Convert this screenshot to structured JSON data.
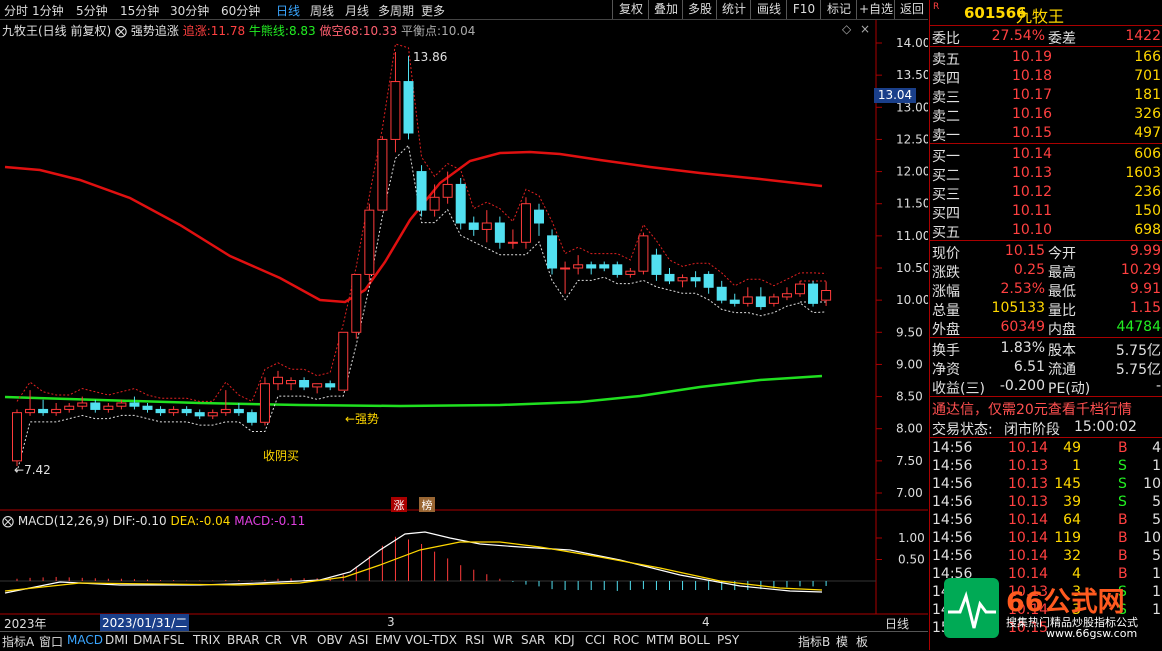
{
  "toolbar": {
    "periods": [
      "分时",
      "1分钟",
      "5分钟",
      "15分钟",
      "30分钟",
      "60分钟",
      "日线",
      "周线",
      "月线",
      "多周期",
      "更多"
    ],
    "active_period": "日线",
    "right_buttons": [
      "复权",
      "叠加",
      "多股",
      "统计",
      "画线",
      "F10",
      "标记",
      "+自选",
      "返回"
    ]
  },
  "chart": {
    "title": "九牧王(日线 前复权)",
    "indicator": "强势追涨",
    "zhuizhang_label": "追涨:",
    "zhuizhang_value": "11.78",
    "niu_label": "牛熊线:",
    "niu_value": "8.83",
    "zuokong_label": "做空68:",
    "zuokong_value": "10.33",
    "ping_label": "平衡点:",
    "ping_value": "10.04",
    "price_ticks": [
      "14.00",
      "13.50",
      "13.00",
      "12.50",
      "12.00",
      "11.50",
      "11.00",
      "10.50",
      "10.00",
      "9.50",
      "9.00",
      "8.50",
      "8.00",
      "7.50",
      "7.00"
    ],
    "current_price_tag": "13.04",
    "high_label": "13.86",
    "low_label": "7.42",
    "strong_label": "←强势",
    "buy_label": "收阴买",
    "zhang_tag": "涨",
    "bang_tag": "榜",
    "macd_label": "MACD(12,26,9)",
    "dif_label": "DIF:",
    "dif_value": "-0.10",
    "dea_label": "DEA:",
    "dea_value": "-0.04",
    "macd_val_label": "MACD:",
    "macd_value": "-0.11",
    "macd_ticks": [
      "1.00",
      "0.50"
    ],
    "date_left": "2023年",
    "date_cursor": "2023/01/31/二",
    "month3": "3",
    "month4": "4",
    "period_tag": "日线"
  },
  "chart_data": {
    "type": "candlestick",
    "ylim": [
      6.8,
      14.3
    ],
    "candles": [
      [
        7.5,
        8.3,
        8.25,
        7.42
      ],
      [
        8.25,
        8.6,
        8.3,
        8.2
      ],
      [
        8.3,
        8.45,
        8.25,
        8.2
      ],
      [
        8.25,
        8.4,
        8.3,
        8.2
      ],
      [
        8.3,
        8.4,
        8.35,
        8.25
      ],
      [
        8.35,
        8.5,
        8.4,
        8.3
      ],
      [
        8.4,
        8.45,
        8.3,
        8.25
      ],
      [
        8.3,
        8.4,
        8.35,
        8.25
      ],
      [
        8.35,
        8.45,
        8.4,
        8.3
      ],
      [
        8.4,
        8.5,
        8.35,
        8.3
      ],
      [
        8.35,
        8.4,
        8.3,
        8.25
      ],
      [
        8.3,
        8.35,
        8.25,
        8.2
      ],
      [
        8.25,
        8.35,
        8.3,
        8.2
      ],
      [
        8.3,
        8.35,
        8.25,
        8.2
      ],
      [
        8.25,
        8.3,
        8.2,
        8.15
      ],
      [
        8.2,
        8.3,
        8.25,
        8.15
      ],
      [
        8.25,
        8.6,
        8.3,
        8.2
      ],
      [
        8.3,
        8.4,
        8.25,
        8.2
      ],
      [
        8.25,
        8.3,
        8.1,
        8.05
      ],
      [
        8.1,
        8.8,
        8.7,
        8.05
      ],
      [
        8.7,
        8.9,
        8.8,
        8.6
      ],
      [
        8.7,
        8.8,
        8.75,
        8.6
      ],
      [
        8.75,
        8.8,
        8.65,
        8.6
      ],
      [
        8.65,
        8.7,
        8.7,
        8.55
      ],
      [
        8.7,
        8.75,
        8.65,
        8.6
      ],
      [
        8.6,
        9.5,
        9.5,
        8.6
      ],
      [
        9.5,
        10.4,
        10.4,
        9.4
      ],
      [
        10.4,
        11.5,
        11.4,
        10.3
      ],
      [
        11.4,
        12.55,
        12.5,
        11.4
      ],
      [
        12.5,
        13.86,
        13.4,
        12.3
      ],
      [
        13.4,
        13.8,
        12.6,
        12.5
      ],
      [
        12.0,
        12.1,
        11.4,
        11.3
      ],
      [
        11.4,
        11.8,
        11.6,
        11.3
      ],
      [
        11.6,
        12.0,
        11.8,
        11.5
      ],
      [
        11.8,
        11.9,
        11.2,
        11.1
      ],
      [
        11.2,
        11.3,
        11.1,
        11.0
      ],
      [
        11.1,
        11.4,
        11.2,
        10.9
      ],
      [
        11.2,
        11.3,
        10.9,
        10.8
      ],
      [
        10.9,
        11.1,
        10.9,
        10.8
      ],
      [
        10.9,
        11.6,
        11.5,
        10.8
      ],
      [
        11.4,
        11.5,
        11.2,
        11.0
      ],
      [
        11.0,
        11.1,
        10.5,
        10.4
      ],
      [
        10.5,
        10.6,
        10.5,
        10.1
      ],
      [
        10.5,
        10.7,
        10.55,
        10.4
      ],
      [
        10.55,
        10.6,
        10.5,
        10.4
      ],
      [
        10.55,
        10.6,
        10.5,
        10.45
      ],
      [
        10.55,
        10.6,
        10.4,
        10.35
      ],
      [
        10.4,
        10.5,
        10.45,
        10.35
      ],
      [
        10.45,
        11.05,
        11.0,
        10.4
      ],
      [
        10.7,
        10.8,
        10.4,
        10.3
      ],
      [
        10.4,
        10.5,
        10.3,
        10.25
      ],
      [
        10.3,
        10.4,
        10.35,
        10.2
      ],
      [
        10.35,
        10.45,
        10.3,
        10.2
      ],
      [
        10.4,
        10.45,
        10.2,
        10.1
      ],
      [
        10.2,
        10.3,
        10.0,
        9.95
      ],
      [
        10.0,
        10.1,
        9.95,
        9.9
      ],
      [
        9.95,
        10.2,
        10.05,
        9.9
      ],
      [
        10.05,
        10.2,
        9.9,
        9.85
      ],
      [
        9.95,
        10.1,
        10.05,
        9.9
      ],
      [
        10.05,
        10.2,
        10.1,
        10.0
      ],
      [
        10.1,
        10.3,
        10.25,
        10.05
      ],
      [
        10.25,
        10.3,
        9.95,
        9.9
      ],
      [
        10.0,
        10.29,
        10.15,
        9.91
      ]
    ]
  },
  "panel": {
    "code": "601566",
    "name": "九牧王",
    "weibi_label": "委比",
    "weibi": "27.54%",
    "weicha_label": "委差",
    "weicha": "1422",
    "sells": [
      {
        "l": "卖五",
        "p": "10.19",
        "v": "166"
      },
      {
        "l": "卖四",
        "p": "10.18",
        "v": "701"
      },
      {
        "l": "卖三",
        "p": "10.17",
        "v": "181"
      },
      {
        "l": "卖二",
        "p": "10.16",
        "v": "326"
      },
      {
        "l": "卖一",
        "p": "10.15",
        "v": "497"
      }
    ],
    "buys": [
      {
        "l": "买一",
        "p": "10.14",
        "v": "606"
      },
      {
        "l": "买二",
        "p": "10.13",
        "v": "1603"
      },
      {
        "l": "买三",
        "p": "10.12",
        "v": "236"
      },
      {
        "l": "买四",
        "p": "10.11",
        "v": "150"
      },
      {
        "l": "买五",
        "p": "10.10",
        "v": "698"
      }
    ],
    "stats": [
      {
        "l1": "现价",
        "v1": "10.15",
        "c1": "red",
        "l2": "今开",
        "v2": "9.99",
        "c2": "red"
      },
      {
        "l1": "涨跌",
        "v1": "0.25",
        "c1": "red",
        "l2": "最高",
        "v2": "10.29",
        "c2": "red"
      },
      {
        "l1": "涨幅",
        "v1": "2.53%",
        "c1": "red",
        "l2": "最低",
        "v2": "9.91",
        "c2": "red"
      },
      {
        "l1": "总量",
        "v1": "105133",
        "c1": "yel",
        "l2": "量比",
        "v2": "1.15",
        "c2": "red"
      },
      {
        "l1": "外盘",
        "v1": "60349",
        "c1": "red",
        "l2": "内盘",
        "v2": "44784",
        "c2": "grn"
      }
    ],
    "stats2": [
      {
        "l1": "换手",
        "v1": "1.83%",
        "l2": "股本",
        "v2": "5.75亿"
      },
      {
        "l1": "净资",
        "v1": "6.51",
        "l2": "流通",
        "v2": "5.75亿"
      },
      {
        "l1": "收益(三)",
        "v1": "-0.200",
        "l2": "PE(动)",
        "v2": "-"
      }
    ],
    "ad": "通达信，仅需20元查看千档行情",
    "status_label": "交易状态:",
    "status_value": "闭市阶段",
    "status_time": "15:00:02",
    "ticks": [
      {
        "t": "14:56",
        "p": "10.14",
        "v": "49",
        "s": "B",
        "n": "4"
      },
      {
        "t": "14:56",
        "p": "10.13",
        "v": "1",
        "s": "S",
        "n": "1"
      },
      {
        "t": "14:56",
        "p": "10.13",
        "v": "145",
        "s": "S",
        "n": "10"
      },
      {
        "t": "14:56",
        "p": "10.13",
        "v": "39",
        "s": "S",
        "n": "5"
      },
      {
        "t": "14:56",
        "p": "10.14",
        "v": "64",
        "s": "B",
        "n": "5"
      },
      {
        "t": "14:56",
        "p": "10.14",
        "v": "119",
        "s": "B",
        "n": "10"
      },
      {
        "t": "14:56",
        "p": "10.14",
        "v": "32",
        "s": "B",
        "n": "5"
      },
      {
        "t": "14:56",
        "p": "10.14",
        "v": "4",
        "s": "B",
        "n": "1"
      },
      {
        "t": "14:56",
        "p": "10.13",
        "v": "3",
        "s": "S",
        "n": "1"
      },
      {
        "t": "14:56",
        "p": "10.14",
        "v": "3",
        "s": "S",
        "n": "1"
      },
      {
        "t": "15:00",
        "p": "10.15",
        "v": "",
        "s": "",
        "n": ""
      }
    ]
  },
  "watermark": {
    "brand": "66公式网",
    "slogan": "搜集热门精品炒股指标公式",
    "url": "www.66gsw.com"
  },
  "bottombar": {
    "items": [
      "指标A",
      "窗口",
      "MACD",
      "DMI",
      "DMA",
      "FSL",
      "TRIX",
      "BRAR",
      "CR",
      "VR",
      "OBV",
      "ASI",
      "EMV",
      "VOL-TDX",
      "RSI",
      "WR",
      "SAR",
      "KDJ",
      "CCI",
      "ROC",
      "MTM",
      "BOLL",
      "PSY",
      "指标B",
      "模",
      "板"
    ],
    "active": "MACD"
  }
}
